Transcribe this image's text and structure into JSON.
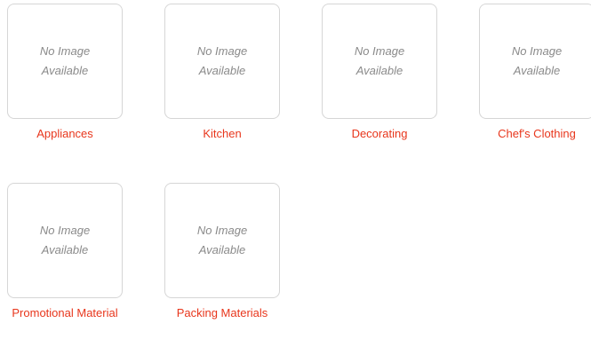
{
  "placeholder": {
    "line1": "No Image",
    "line2": "Available"
  },
  "categories": [
    {
      "label": "Appliances"
    },
    {
      "label": "Kitchen"
    },
    {
      "label": "Decorating"
    },
    {
      "label": "Chef's Clothing"
    },
    {
      "label": "Promotional Material"
    },
    {
      "label": "Packing Materials"
    }
  ],
  "colors": {
    "link": "#e8361c",
    "placeholder_text": "#8a8a8a",
    "border": "#d6d6d6"
  }
}
